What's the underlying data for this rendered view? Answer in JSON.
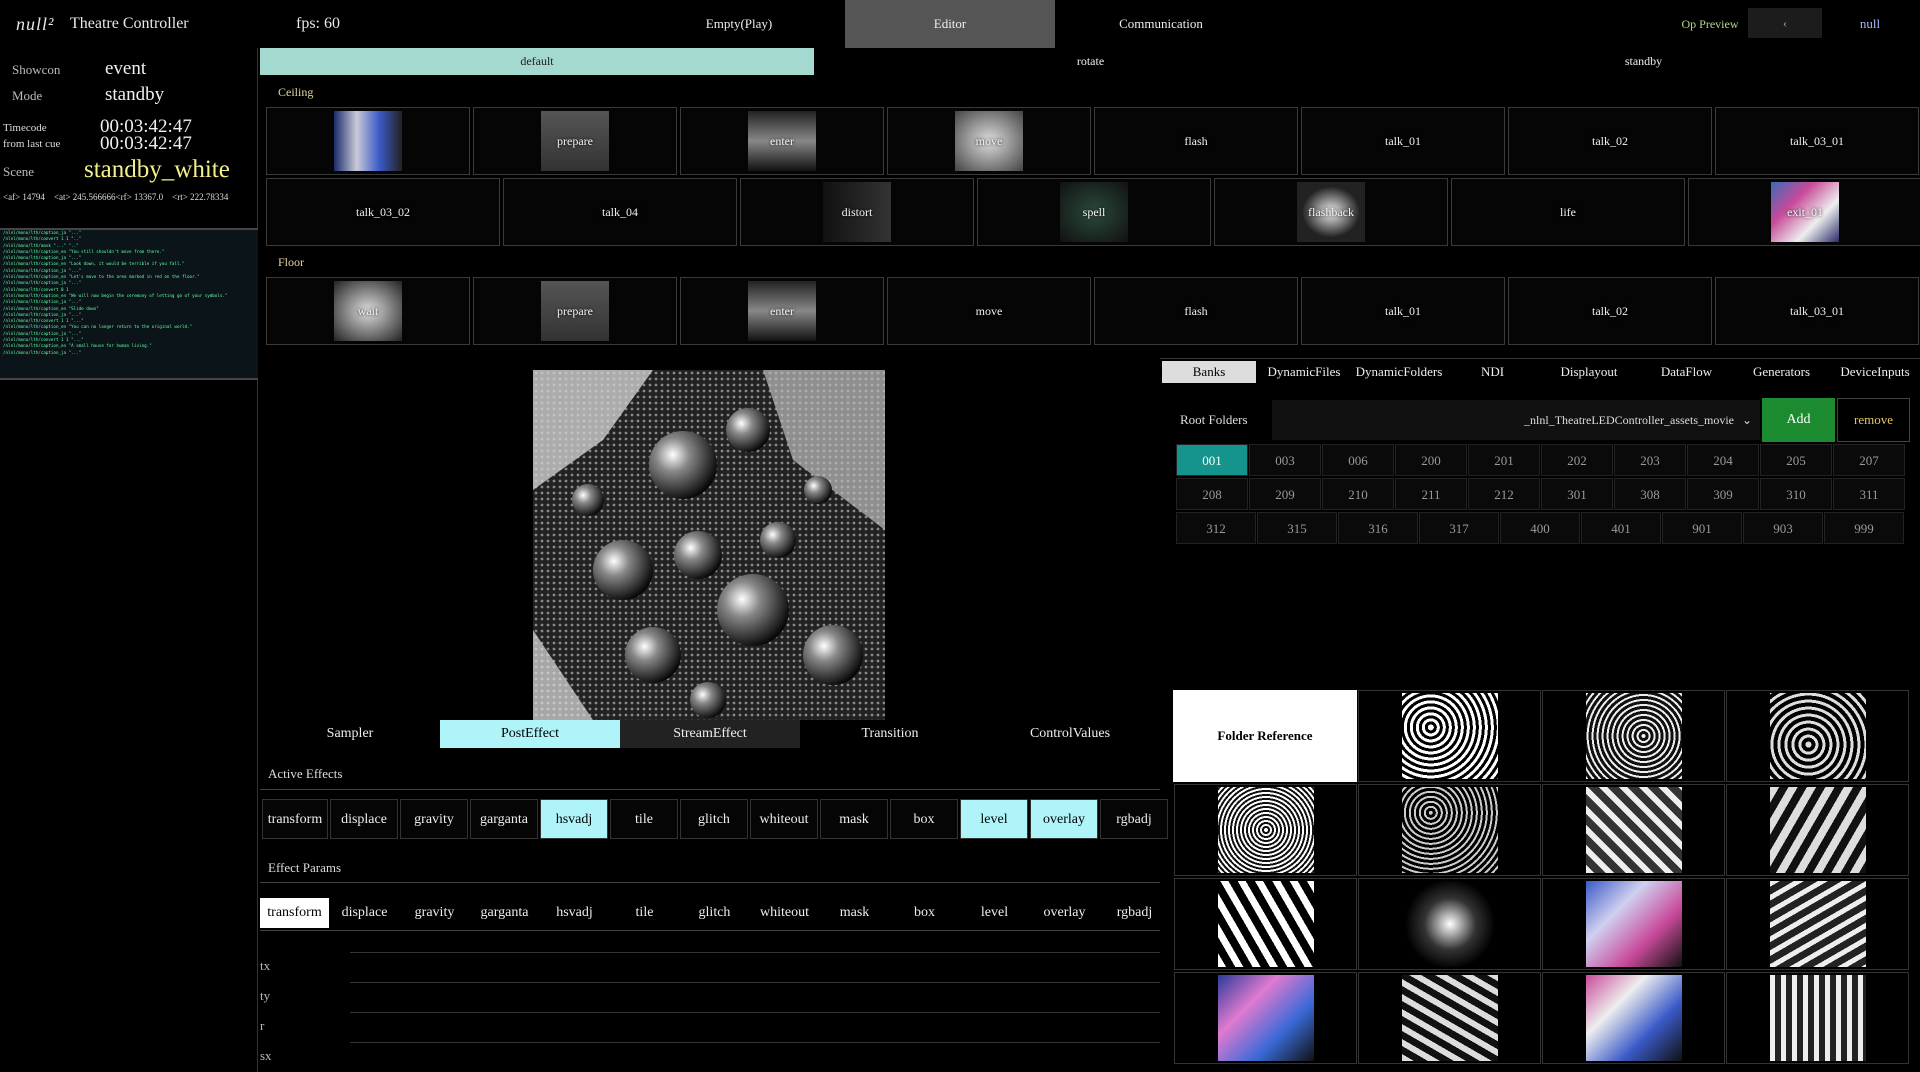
{
  "app": {
    "logo": "null²",
    "title": "Theatre Controller",
    "fps_label": "fps: 60",
    "nav": [
      "Empty(Play)",
      "Editor",
      "Communication"
    ],
    "op_preview": "Op Preview",
    "op_value": "‹",
    "user": "null"
  },
  "status": {
    "showcon_label": "Showcon",
    "showcon_value": "event",
    "mode_label": "Mode",
    "mode_value": "standby",
    "timecode_label": "Timecode",
    "timecode_value": "00:03:42:47",
    "last_cue_label": "from last cue",
    "last_cue_value": "00:03:42:47",
    "scene_label": "Scene",
    "scene_value": "standby_white",
    "counters": "<af> 14794    <at> 245.566666<rf> 13367.0    <rt> 222.78334"
  },
  "log_lines": [
    "/nlnl/mono/lth/caption_ja \"...\"",
    "/nlnl/mono/lth/convert 1 1 \"..\"",
    "/nlnl/mono/lth/mask \"...\" \"..\"",
    "/nlnl/mono/lth/caption_en \"You still shouldn't move from there.\"",
    "/nlnl/mono/lth/caption_ja \"...\"",
    "/nlnl/mono/lth/caption_en \"Look down, it would be terrible if you fall.\"",
    "/nlnl/mono/lth/caption_ja \"...\"",
    "/nlnl/mono/lth/caption_en \"Let's move to the area marked in red on the floor.\"",
    "/nlnl/mono/lth/caption_ja \"...\"",
    "/nlnl/mono/lth/convert 0 1",
    "/nlnl/mono/lth/caption_en \"We will now begin the ceremony of letting go of your symbols.\"",
    "/nlnl/mono/lth/caption_ja \"...\"",
    "/nlnl/mono/lth/caption_en \"Slide down\"",
    "/nlnl/mono/lth/caption_ja \"...\"",
    "/nlnl/mono/lth/convert 1 1 \"...\"",
    "/nlnl/mono/lth/caption_en \"You can no longer return to the original world.\"",
    "/nlnl/mono/lth/caption_ja \"...\"",
    "/nlnl/mono/lth/convert 1 1 \"...\"",
    "/nlnl/mono/lth/caption_en \"A small house for human living.\"",
    "/nlnl/mono/lth/caption_ja \"...\""
  ],
  "scene_tabs": [
    "default",
    "rotate",
    "standby"
  ],
  "ceiling_label": "Ceiling",
  "floor_label": "Floor",
  "ceiling_row1": [
    "",
    "prepare",
    "enter",
    "move",
    "flash",
    "talk_01",
    "talk_02",
    "talk_03_01"
  ],
  "ceiling_row2": [
    "talk_03_02",
    "talk_04",
    "distort",
    "spell",
    "flashback",
    "life",
    "exit_01"
  ],
  "floor_row1": [
    "wait",
    "prepare",
    "enter",
    "move",
    "flash",
    "talk_01",
    "talk_02",
    "talk_03_01"
  ],
  "panel_tabs": [
    "Sampler",
    "PostEffect",
    "StreamEffect",
    "Transition",
    "ControlValues"
  ],
  "active_effects_label": "Active Effects",
  "effect_params_label": "Effect Params",
  "effects": [
    "transform",
    "displace",
    "gravity",
    "garganta",
    "hsvadj",
    "tile",
    "glitch",
    "whiteout",
    "mask",
    "box",
    "level",
    "overlay",
    "rgbadj"
  ],
  "active_effects_on": [
    "hsvadj",
    "level",
    "overlay"
  ],
  "params": [
    "tx",
    "ty",
    "r",
    "sx"
  ],
  "right_tabs": [
    "Banks",
    "DynamicFiles",
    "DynamicFolders",
    "NDI",
    "Displayout",
    "DataFlow",
    "Generators",
    "DeviceInputs"
  ],
  "root_folders_label": "Root Folders",
  "root_folder_value": "_nlnl_TheatreLEDController_assets_movie",
  "add_label": "Add",
  "remove_label": "remove",
  "banks_row1": [
    "001",
    "003",
    "006",
    "200",
    "201",
    "202",
    "203",
    "204",
    "205",
    "207"
  ],
  "banks_row2": [
    "208",
    "209",
    "210",
    "211",
    "212",
    "301",
    "308",
    "309",
    "310",
    "311"
  ],
  "banks_row3": [
    "312",
    "315",
    "316",
    "317",
    "400",
    "401",
    "901",
    "903",
    "999"
  ],
  "folder_reference_label": "Folder Reference",
  "colors": {
    "accent_teal": "#a3d9cf",
    "active_cyan": "#aef4f8",
    "scene_yellow": "#f3f08a",
    "op_preview_green": "#b0d98a",
    "add_green": "#1c8a2e",
    "remove_text": "#e8c25c",
    "bank_selected": "#14948c"
  }
}
